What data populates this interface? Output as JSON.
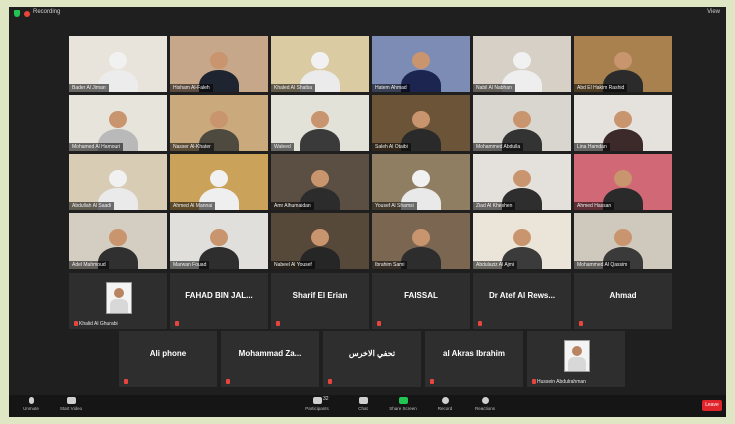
{
  "topbar": {
    "recording_label": "Recording",
    "view_label": "View"
  },
  "gallery": {
    "rows": [
      [
        {
          "name": "Bader Al Jiman",
          "wall": "#e9e4db",
          "shirt": "#ececec",
          "ghutra": true
        },
        {
          "name": "Hisham Al-Faleh",
          "wall": "#c7a78a",
          "shirt": "#1f2530",
          "ghutra": false
        },
        {
          "name": "Khaled Al Shaiba",
          "wall": "#dbcba2",
          "shirt": "#ebebeb",
          "ghutra": true
        },
        {
          "name": "Hatem Ahmad",
          "wall": "#7d8cb5",
          "shirt": "#1c2550",
          "ghutra": false
        },
        {
          "name": "Nabil Al Nabhan",
          "wall": "#d7d0c6",
          "shirt": "#eeeeee",
          "ghutra": true
        },
        {
          "name": "Abd El Hakim Rashid",
          "wall": "#a8814f",
          "shirt": "#2b2b2b",
          "ghutra": false
        }
      ],
      [
        {
          "name": "Mohamed Al Hamouri",
          "wall": "#e7e4dc",
          "shirt": "#b9b9b9",
          "ghutra": false
        },
        {
          "name": "Nasser Al-Khater",
          "wall": "#caa97c",
          "shirt": "#4f4a40",
          "ghutra": false
        },
        {
          "name": "Waleed",
          "wall": "#e2e2d9",
          "shirt": "#3a3a3a",
          "ghutra": false
        },
        {
          "name": "Saleh Al Otaibi",
          "wall": "#6b5438",
          "shirt": "#2a2a2a",
          "ghutra": false
        },
        {
          "name": "Mohammed Abdulla",
          "wall": "#d9d6d0",
          "shirt": "#333333",
          "ghutra": false
        },
        {
          "name": "Lina Hamdan",
          "wall": "#e5e1dd",
          "shirt": "#3c2a2a",
          "ghutra": false
        }
      ],
      [
        {
          "name": "Abdullah Al Saadi",
          "wall": "#d8cdb4",
          "shirt": "#eaeaea",
          "ghutra": true
        },
        {
          "name": "Ahmed Al Mannai",
          "wall": "#caa25a",
          "shirt": "#efefef",
          "ghutra": true
        },
        {
          "name": "Amr Alhumaidan",
          "wall": "#5a4f42",
          "shirt": "#2c2c2c",
          "ghutra": false
        },
        {
          "name": "Yousef Al Shamsi",
          "wall": "#8f7e62",
          "shirt": "#e9e9e9",
          "ghutra": true
        },
        {
          "name": "Ziad Al Kheshen",
          "wall": "#e4e0dc",
          "shirt": "#2e2e2e",
          "ghutra": false
        },
        {
          "name": "Ahmed Hassan",
          "wall": "#d06875",
          "shirt": "#2a2a2a",
          "ghutra": false
        }
      ],
      [
        {
          "name": "Adel Mahmoud",
          "wall": "#d4cdc1",
          "shirt": "#303030",
          "ghutra": false
        },
        {
          "name": "Marwan Fouad",
          "wall": "#e1dfdc",
          "shirt": "#2e2e2e",
          "ghutra": false
        },
        {
          "name": "Nabeel Al Yousef",
          "wall": "#57493a",
          "shirt": "#262626",
          "ghutra": false
        },
        {
          "name": "Ibrahim Sami",
          "wall": "#7b6652",
          "shirt": "#2d2d2d",
          "ghutra": false
        },
        {
          "name": "Abdulaziz Al Ajmi",
          "wall": "#ebe4d8",
          "shirt": "#3b3b3b",
          "ghutra": false
        },
        {
          "name": "Mohammed Al Qassim",
          "wall": "#cfc8bd",
          "shirt": "#3a3a3a",
          "ghutra": false
        }
      ]
    ],
    "off_row1": [
      {
        "name": "",
        "small": "Khalid Al Ghurabi",
        "has_photo": true
      },
      {
        "name": "FAHAD BIN JAL...",
        "small": "",
        "has_photo": false
      },
      {
        "name": "Sharif El Erian",
        "small": "",
        "has_photo": false
      },
      {
        "name": "FAISSAL",
        "small": "",
        "has_photo": false
      },
      {
        "name": "Dr Atef Al Rews...",
        "small": "",
        "has_photo": false
      },
      {
        "name": "Ahmad",
        "small": "",
        "has_photo": false
      }
    ],
    "off_row2": [
      {
        "name": "Ali phone",
        "small": "",
        "has_photo": false
      },
      {
        "name": "Mohammad Za...",
        "small": "",
        "has_photo": false
      },
      {
        "name": "تحفي الاخرس",
        "small": "",
        "has_photo": false
      },
      {
        "name": "al Akras Ibrahim",
        "small": "",
        "has_photo": false
      },
      {
        "name": "",
        "small": "Hussein Abdulrahman",
        "has_photo": true
      }
    ]
  },
  "toolbar": {
    "unmute": "Unmute",
    "start_video": "Start Video",
    "participants": "Participants",
    "participants_count": "32",
    "chat": "Chat",
    "share_screen": "Share Screen",
    "record": "Record",
    "reactions": "Reactions",
    "leave": "Leave"
  },
  "colors": {
    "share": "#23c552",
    "leave": "#e0242c",
    "background": "#1f1f1f"
  }
}
